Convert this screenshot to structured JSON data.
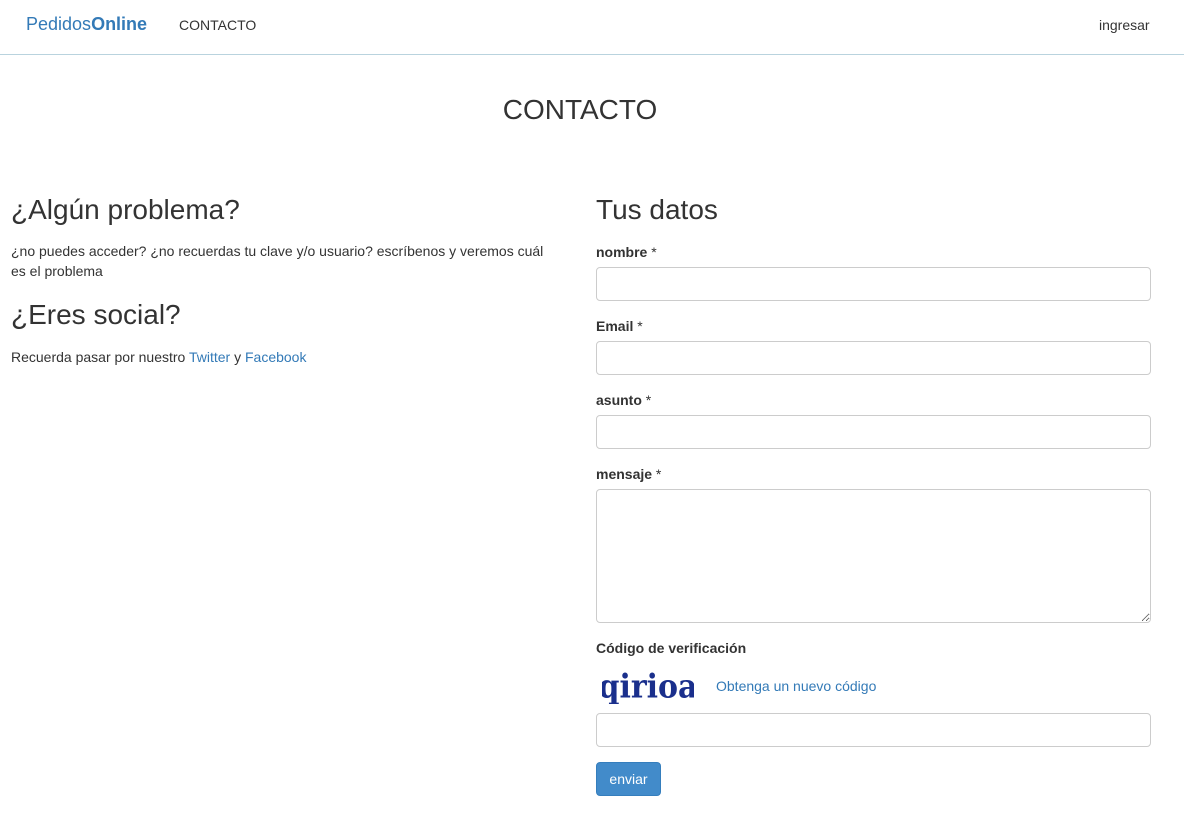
{
  "navbar": {
    "brand_part1": "Pedidos",
    "brand_part2": "Online",
    "link_contacto": "CONTACTO",
    "link_ingresar": "ingresar"
  },
  "page": {
    "title": "CONTACTO"
  },
  "left": {
    "problem_heading": "¿Algún problema?",
    "problem_text": "¿no puedes acceder? ¿no recuerdas tu clave y/o usuario? escríbenos y veremos cuál es el problema",
    "social_heading": "¿Eres social?",
    "social_text_prefix": "Recuerda pasar por nuestro ",
    "twitter_link": "Twitter",
    "social_text_and": " y ",
    "facebook_link": "Facebook"
  },
  "form": {
    "heading": "Tus datos",
    "nombre_label": "nombre",
    "email_label": "Email",
    "asunto_label": "asunto",
    "mensaje_label": "mensaje",
    "required_mark": " *",
    "nombre_value": "",
    "email_value": "",
    "asunto_value": "",
    "mensaje_value": "",
    "captcha_label": "Código de verificación",
    "captcha_text": "qirioa",
    "captcha_refresh_link": "Obtenga un nuevo código",
    "captcha_value": "",
    "submit_label": "enviar"
  },
  "colors": {
    "link": "#337ab7",
    "button": "#428bca",
    "captcha": "#1a2f8c"
  }
}
